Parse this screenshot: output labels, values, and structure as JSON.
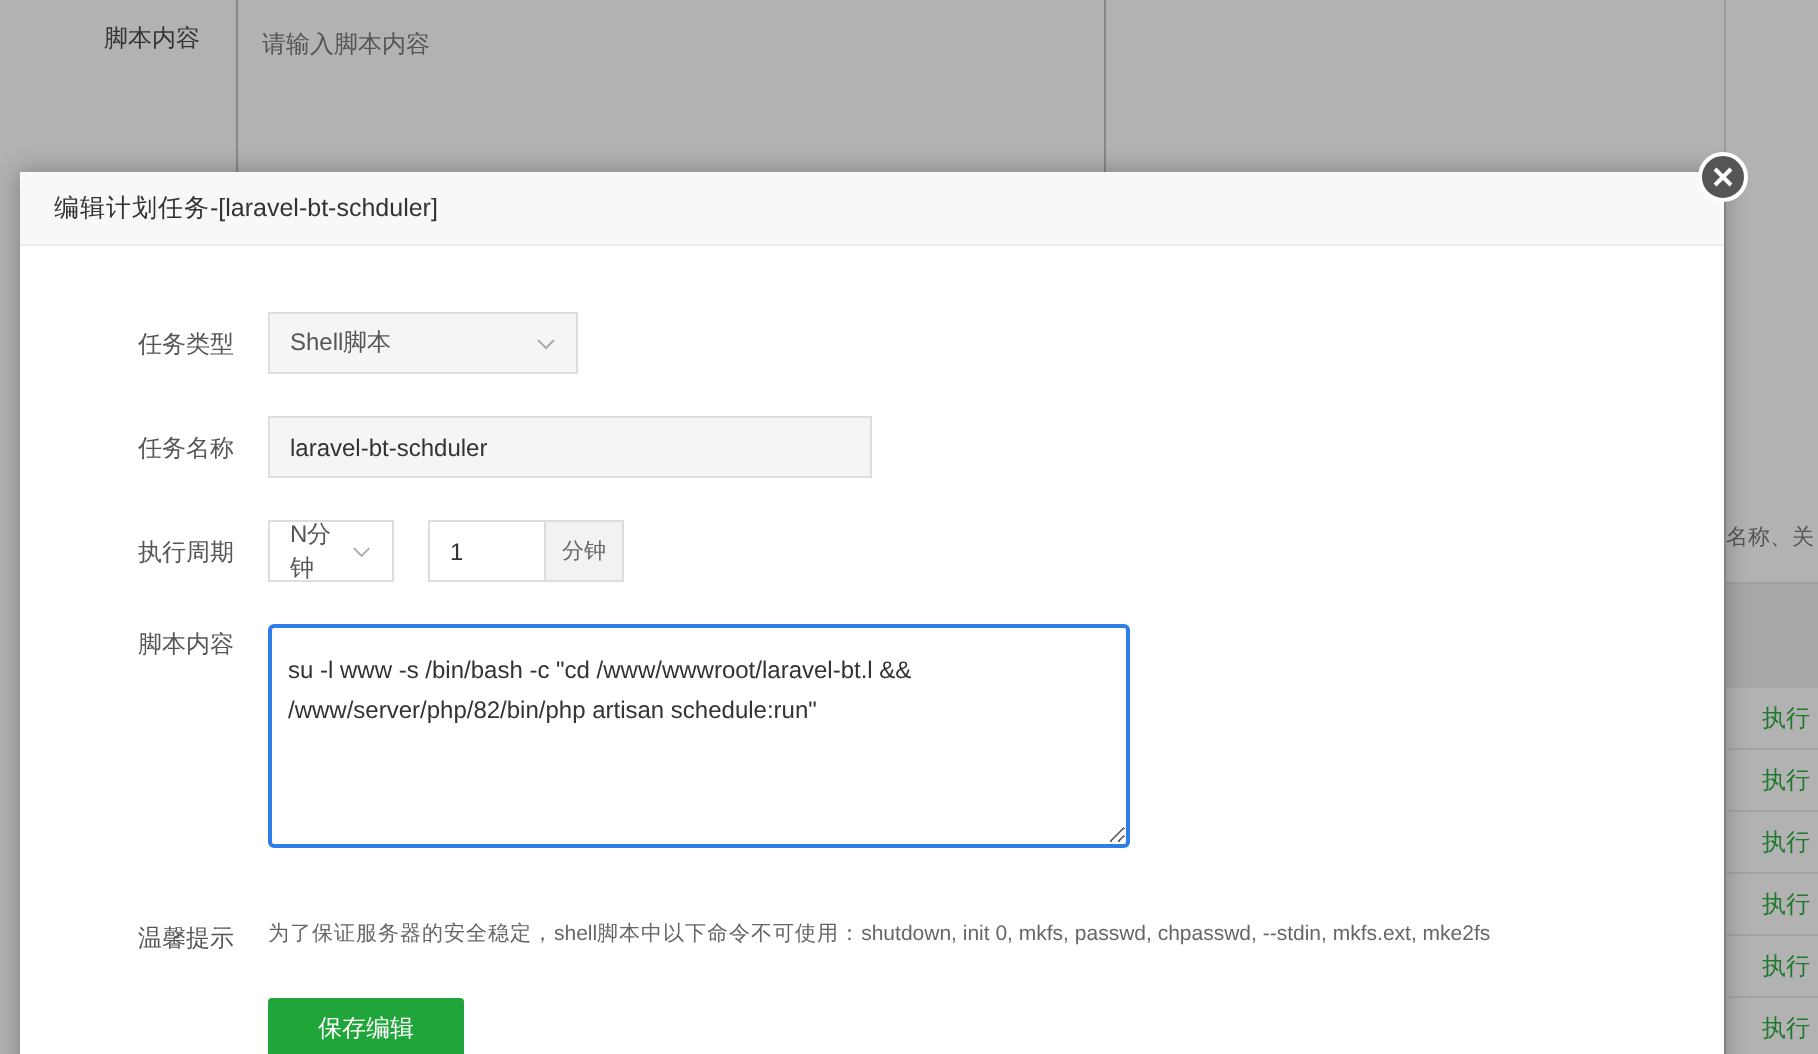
{
  "background": {
    "script_label": "脚本内容",
    "script_placeholder": "请输入脚本内容",
    "search_placeholder": "名称、关",
    "row_actions": [
      "执行",
      "执行",
      "执行",
      "执行",
      "执行",
      "执行"
    ]
  },
  "dialog": {
    "title": "编辑计划任务-[laravel-bt-schduler]",
    "fields": [
      {
        "kind": "select",
        "label": "任务类型",
        "value": "Shell脚本"
      },
      {
        "kind": "text",
        "label": "任务名称",
        "value": "laravel-bt-schduler"
      },
      {
        "kind": "period",
        "label": "执行周期",
        "value": "N分钟",
        "number": "1",
        "unit": "分钟"
      },
      {
        "kind": "script",
        "label": "脚本内容",
        "value": "su -l www -s /bin/bash -c \"cd /www/wwwroot/laravel-bt.l &&\n/www/server/php/82/bin/php artisan schedule:run\""
      },
      {
        "kind": "hint",
        "label": "温馨提示",
        "value": "为了保证服务器的安全稳定，shell脚本中以下命令不可使用：shutdown, init 0, mkfs, passwd, chpasswd, --stdin, mkfs.ext, mke2fs"
      }
    ],
    "save_button": "保存编辑"
  }
}
